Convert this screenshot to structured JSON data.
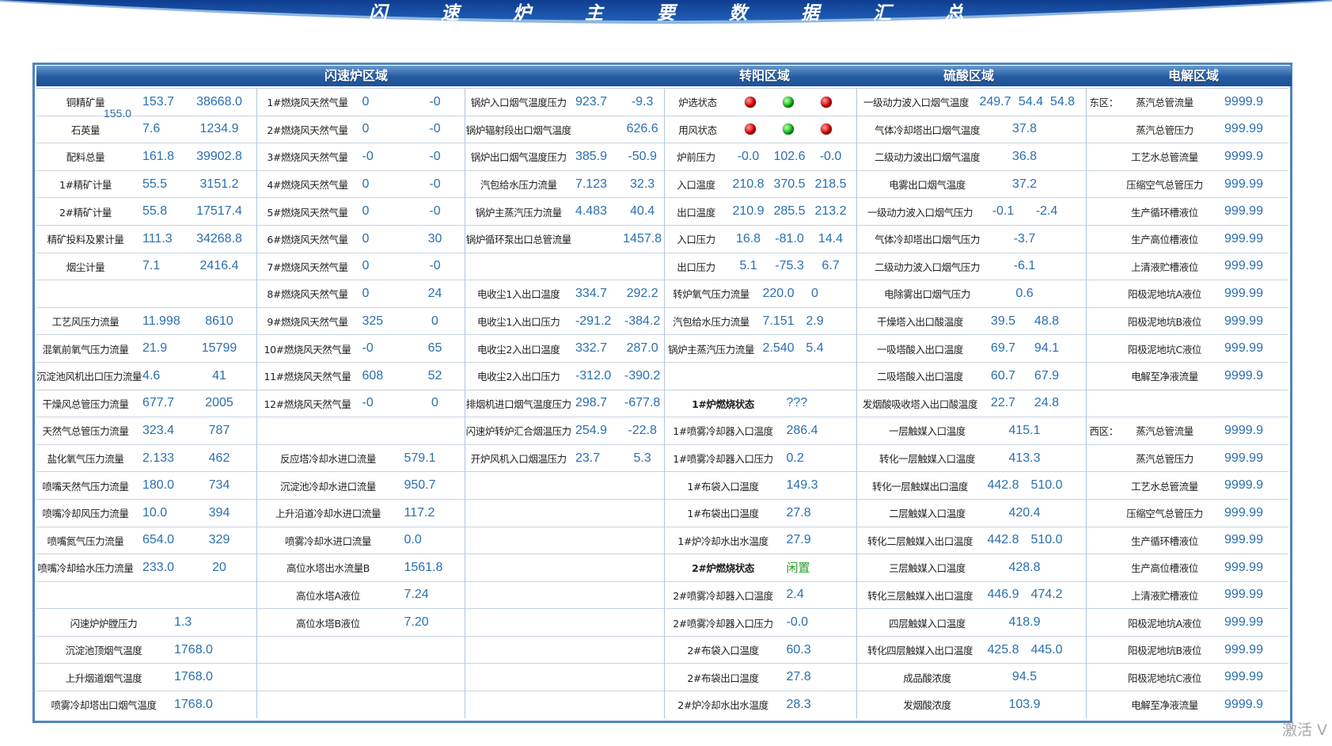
{
  "title": "闪 速 炉 主 要 数 据 汇 总",
  "headers": {
    "flash": "闪速炉区域",
    "converter": "转阳区域",
    "acid": "硫酸区域",
    "electrolysis": "电解区域"
  },
  "ore_total": "155.0",
  "watermark": "激活 V",
  "colors": {
    "banner": "#1b4fa6",
    "header": "#245b9f",
    "value": "#2a6fb0",
    "status_red": "#e00000",
    "status_green": "#13c013"
  },
  "rows": [
    {
      "a": [
        "铜精矿量",
        "153.7",
        "38668.0"
      ],
      "b": [
        "1#燃烧风天然气量",
        "0",
        "-0"
      ],
      "c": [
        "锅炉入口烟气温度压力",
        "923.7",
        "-9.3"
      ],
      "d": {
        "status": "炉选状态",
        "dots": [
          "red",
          "green",
          "red"
        ]
      },
      "e": [
        "一级动力波入口烟气温度",
        "249.7",
        "54.4",
        "54.8"
      ],
      "f": [
        "东区：",
        "蒸汽总管流量",
        "9999.9"
      ]
    },
    {
      "a": [
        "石英量",
        "7.6",
        "1234.9"
      ],
      "b": [
        "2#燃烧风天然气量",
        "0",
        "-0"
      ],
      "c": [
        "锅炉辐射段出口烟气温度",
        "",
        "626.6"
      ],
      "d": {
        "status": "用风状态",
        "dots": [
          "red",
          "green",
          "red"
        ]
      },
      "e": [
        "气体冷却塔出口烟气温度",
        "37.8"
      ],
      "f": [
        "",
        "蒸汽总管压力",
        "999.99"
      ]
    },
    {
      "a": [
        "配料总量",
        "161.8",
        "39902.8"
      ],
      "b": [
        "3#燃烧风天然气量",
        "-0",
        "-0"
      ],
      "c": [
        "锅炉出口烟气温度压力",
        "385.9",
        "-50.9"
      ],
      "d": [
        "炉前压力",
        "-0.0",
        "102.6",
        "-0.0"
      ],
      "e": [
        "二级动力波出口烟气温度",
        "36.8"
      ],
      "f": [
        "",
        "工艺水总管流量",
        "9999.9"
      ]
    },
    {
      "a": [
        "1#精矿计量",
        "55.5",
        "3151.2"
      ],
      "b": [
        "4#燃烧风天然气量",
        "0",
        "-0"
      ],
      "c": [
        "汽包给水压力流量",
        "7.123",
        "32.3"
      ],
      "d": [
        "入口温度",
        "210.8",
        "370.5",
        "218.5"
      ],
      "e": [
        "电雾出口烟气温度",
        "37.2"
      ],
      "f": [
        "",
        "压缩空气总管压力",
        "999.99"
      ]
    },
    {
      "a": [
        "2#精矿计量",
        "55.8",
        "17517.4"
      ],
      "b": [
        "5#燃烧风天然气量",
        "0",
        "-0"
      ],
      "c": [
        "锅炉主蒸汽压力流量",
        "4.483",
        "40.4"
      ],
      "d": [
        "出口温度",
        "210.9",
        "285.5",
        "213.2"
      ],
      "e": [
        "一级动力波入口烟气压力",
        "-0.1",
        "-2.4"
      ],
      "f": [
        "",
        "生产循环槽液位",
        "999.99"
      ]
    },
    {
      "a": [
        "精矿投料及累计量",
        "111.3",
        "34268.8"
      ],
      "b": [
        "6#燃烧风天然气量",
        "0",
        "30"
      ],
      "c": [
        "锅炉循环泵出口总管流量",
        "",
        "1457.8"
      ],
      "d": [
        "入口压力",
        "16.8",
        "-81.0",
        "14.4"
      ],
      "e": [
        "气体冷却塔出口烟气压力",
        "-3.7"
      ],
      "f": [
        "",
        "生产高位槽液位",
        "999.99"
      ]
    },
    {
      "a": [
        "烟尘计量",
        "7.1",
        "2416.4"
      ],
      "b": [
        "7#燃烧风天然气量",
        "0",
        "-0"
      ],
      "c": [],
      "d": [
        "出口压力",
        "5.1",
        "-75.3",
        "6.7"
      ],
      "e": [
        "二级动力波入口烟气压力",
        "-6.1"
      ],
      "f": [
        "",
        "上清液贮槽液位",
        "999.99"
      ]
    },
    {
      "a": [],
      "b": [
        "8#燃烧风天然气量",
        "0",
        "24"
      ],
      "c": [
        "电收尘1入出口温度",
        "334.7",
        "292.2"
      ],
      "d": [
        "转炉氧气压力流量",
        "220.0",
        "0"
      ],
      "e": [
        "电除雾出口烟气压力",
        "0.6"
      ],
      "f": [
        "",
        "阳极泥地坑A液位",
        "999.99"
      ]
    },
    {
      "a": [
        "工艺风压力流量",
        "11.998",
        "8610"
      ],
      "b": [
        "9#燃烧风天然气量",
        "325",
        "0"
      ],
      "c": [
        "电收尘1入出口压力",
        "-291.2",
        "-384.2"
      ],
      "d": [
        "汽包给水压力流量",
        "7.151",
        "2.9"
      ],
      "e": [
        "干燥塔入出口酸温度",
        "39.5",
        "48.8"
      ],
      "f": [
        "",
        "阳极泥地坑B液位",
        "999.99"
      ]
    },
    {
      "a": [
        "混氧前氧气压力流量",
        "21.9",
        "15799"
      ],
      "b": [
        "10#燃烧风天然气量",
        "-0",
        "65"
      ],
      "c": [
        "电收尘2入出口温度",
        "332.7",
        "287.0"
      ],
      "d": [
        "锅炉主蒸汽压力流量",
        "2.540",
        "5.4"
      ],
      "e": [
        "一吸塔酸入出口温度",
        "69.7",
        "94.1"
      ],
      "f": [
        "",
        "阳极泥地坑C液位",
        "999.99"
      ]
    },
    {
      "a": [
        "沉淀池风机出口压力流量",
        "4.6",
        "41"
      ],
      "b": [
        "11#燃烧风天然气量",
        "608",
        "52"
      ],
      "c": [
        "电收尘2入出口压力",
        "-312.0",
        "-390.2"
      ],
      "d": [],
      "e": [
        "二吸塔酸入出口温度",
        "60.7",
        "67.9"
      ],
      "f": [
        "",
        "电解至净液流量",
        "9999.9"
      ]
    },
    {
      "a": [
        "干燥风总管压力流量",
        "677.7",
        "2005"
      ],
      "b": [
        "12#燃烧风天然气量",
        "-0",
        "0"
      ],
      "c": [
        "排烟机进口烟气温度压力",
        "298.7",
        "-677.8"
      ],
      "d": {
        "bold": "1#炉燃烧状态",
        "value": "???"
      },
      "e": [
        "发烟酸吸收塔入出口酸温度",
        "22.7",
        "24.8"
      ],
      "f": []
    },
    {
      "a": [
        "天然气总管压力流量",
        "323.4",
        "787"
      ],
      "b": [],
      "c": [
        "闪速炉转炉汇合烟温压力",
        "254.9",
        "-22.8"
      ],
      "d": [
        "1#喷雾冷却器入口温度",
        "286.4"
      ],
      "e": [
        "一层触媒入口温度",
        "415.1"
      ],
      "f": [
        "西区：",
        "蒸汽总管流量",
        "9999.9"
      ]
    },
    {
      "a": [
        "盐化氧气压力流量",
        "2.133",
        "462"
      ],
      "b": [
        "反应塔冷却水进口流量",
        "579.1"
      ],
      "c": [
        "开炉风机入口烟温压力",
        "23.7",
        "5.3"
      ],
      "d": [
        "1#喷雾冷却器入口压力",
        "0.2"
      ],
      "e": [
        "转化一层触媒入口温度",
        "413.3"
      ],
      "f": [
        "",
        "蒸汽总管压力",
        "999.99"
      ]
    },
    {
      "a": [
        "喷嘴天然气压力流量",
        "180.0",
        "734"
      ],
      "b": [
        "沉淀池冷却水进口流量",
        "950.7"
      ],
      "c": [],
      "d": [
        "1#布袋入口温度",
        "149.3"
      ],
      "e": [
        "转化一层触媒出口温度",
        "442.8",
        "510.0"
      ],
      "f": [
        "",
        "工艺水总管流量",
        "9999.9"
      ]
    },
    {
      "a": [
        "喷嘴冷却风压力流量",
        "10.0",
        "394"
      ],
      "b": [
        "上升沿道冷却水进口流量",
        "117.2"
      ],
      "c": [],
      "d": [
        "1#布袋出口温度",
        "27.8"
      ],
      "e": [
        "二层触媒入口温度",
        "420.4"
      ],
      "f": [
        "",
        "压缩空气总管压力",
        "999.99"
      ]
    },
    {
      "a": [
        "喷嘴氮气压力流量",
        "654.0",
        "329"
      ],
      "b": [
        "喷雾冷却水进口流量",
        "0.0"
      ],
      "c": [],
      "d": [
        "1#炉冷却水出水温度",
        "27.9"
      ],
      "e": [
        "转化二层触媒入出口温度",
        "442.8",
        "510.0"
      ],
      "f": [
        "",
        "生产循环槽液位",
        "999.99"
      ]
    },
    {
      "a": [
        "喷嘴冷却给水压力流量",
        "233.0",
        "20"
      ],
      "b": [
        "高位水塔出水流量B",
        "1561.8"
      ],
      "c": [],
      "d": {
        "bold": "2#炉燃烧状态",
        "value": "闲置"
      },
      "e": [
        "三层触媒入口温度",
        "428.8"
      ],
      "f": [
        "",
        "生产高位槽液位",
        "999.99"
      ]
    },
    {
      "a": [],
      "b": [
        "高位水塔A液位",
        "7.24"
      ],
      "c": [],
      "d": [
        "2#喷雾冷却器入口温度",
        "2.4"
      ],
      "e": [
        "转化三层触媒入出口温度",
        "446.9",
        "474.2"
      ],
      "f": [
        "",
        "上清液贮槽液位",
        "999.99"
      ]
    },
    {
      "a": [
        "闪速炉炉膛压力",
        "1.3"
      ],
      "b": [
        "高位水塔B液位",
        "7.20"
      ],
      "c": [],
      "d": [
        "2#喷雾冷却器入口压力",
        "-0.0"
      ],
      "e": [
        "四层触媒入口温度",
        "418.9"
      ],
      "f": [
        "",
        "阳极泥地坑A液位",
        "999.99"
      ]
    },
    {
      "a": [
        "沉淀池顶烟气温度",
        "1768.0"
      ],
      "b": [],
      "c": [],
      "d": [
        "2#布袋入口温度",
        "60.3"
      ],
      "e": [
        "转化四层触媒入出口温度",
        "425.8",
        "445.0"
      ],
      "f": [
        "",
        "阳极泥地坑B液位",
        "999.99"
      ]
    },
    {
      "a": [
        "上升烟道烟气温度",
        "1768.0"
      ],
      "b": [],
      "c": [],
      "d": [
        "2#布袋出口温度",
        "27.8"
      ],
      "e": [
        "成品酸浓度",
        "94.5"
      ],
      "f": [
        "",
        "阳极泥地坑C液位",
        "999.99"
      ]
    },
    {
      "a": [
        "喷雾冷却塔出口烟气温度",
        "1768.0"
      ],
      "b": [],
      "c": [],
      "d": [
        "2#炉冷却水出水温度",
        "28.3"
      ],
      "e": [
        "发烟酸浓度",
        "103.9"
      ],
      "f": [
        "",
        "电解至净液流量",
        "9999.9"
      ]
    }
  ]
}
